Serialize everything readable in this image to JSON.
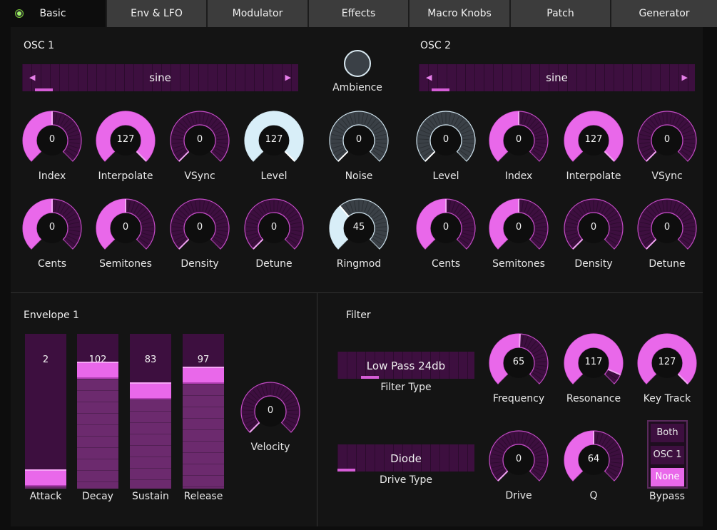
{
  "tabs": {
    "items": [
      {
        "label": "Basic",
        "active": true
      },
      {
        "label": "Env & LFO"
      },
      {
        "label": "Modulator"
      },
      {
        "label": "Effects"
      },
      {
        "label": "Macro Knobs"
      },
      {
        "label": "Patch"
      },
      {
        "label": "Generator"
      }
    ]
  },
  "osc1": {
    "title": "OSC  1",
    "waveform": "sine",
    "waveform_position": 0.05,
    "knobs": [
      {
        "label": "Index",
        "value": "0",
        "fraction": 0.5,
        "style": "pink"
      },
      {
        "label": "Interpolate",
        "value": "127",
        "fraction": 1.0,
        "style": "pink"
      },
      {
        "label": "VSync",
        "value": "0",
        "fraction": 0.0,
        "style": "pink"
      },
      {
        "label": "Level",
        "value": "127",
        "fraction": 1.0,
        "style": "blue"
      },
      {
        "label": "Cents",
        "value": "0",
        "fraction": 0.5,
        "style": "pink"
      },
      {
        "label": "Semitones",
        "value": "0",
        "fraction": 0.5,
        "style": "pink"
      },
      {
        "label": "Density",
        "value": "0",
        "fraction": 0.0,
        "style": "pink"
      },
      {
        "label": "Detune",
        "value": "0",
        "fraction": 0.0,
        "style": "pink"
      }
    ]
  },
  "middle": {
    "ambience_label": "Ambience",
    "knobs": [
      {
        "label": "Noise",
        "value": "0",
        "fraction": 0.0,
        "style": "blue"
      },
      {
        "label": "Ringmod",
        "value": "45",
        "fraction": 0.35,
        "style": "blue"
      }
    ]
  },
  "osc2": {
    "title": "OSC 2",
    "waveform": "sine",
    "waveform_position": 0.05,
    "knobs": [
      {
        "label": "Level",
        "value": "0",
        "fraction": 0.0,
        "style": "blue"
      },
      {
        "label": "Index",
        "value": "0",
        "fraction": 0.5,
        "style": "pink"
      },
      {
        "label": "Interpolate",
        "value": "127",
        "fraction": 1.0,
        "style": "pink"
      },
      {
        "label": "VSync",
        "value": "0",
        "fraction": 0.0,
        "style": "pink"
      },
      {
        "label": "Cents",
        "value": "0",
        "fraction": 0.5,
        "style": "pink"
      },
      {
        "label": "Semitones",
        "value": "0",
        "fraction": 0.5,
        "style": "pink"
      },
      {
        "label": "Density",
        "value": "0",
        "fraction": 0.0,
        "style": "pink"
      },
      {
        "label": "Detune",
        "value": "0",
        "fraction": 0.0,
        "style": "pink"
      }
    ]
  },
  "envelope": {
    "title": "Envelope 1",
    "sliders": [
      {
        "label": "Attack",
        "value": "2",
        "fraction": 0.015
      },
      {
        "label": "Decay",
        "value": "102",
        "fraction": 0.8
      },
      {
        "label": "Sustain",
        "value": "83",
        "fraction": 0.65
      },
      {
        "label": "Release",
        "value": "97",
        "fraction": 0.76
      }
    ],
    "velocity": {
      "label": "Velocity",
      "value": "0",
      "fraction": 0.0,
      "style": "pink"
    }
  },
  "filter": {
    "title": "Filter",
    "filter_type": {
      "label": "Filter Type",
      "value": "Low Pass 24db",
      "position": 0.2
    },
    "drive_type": {
      "label": "Drive Type",
      "value": "Diode",
      "position": 0.0
    },
    "knobs": [
      {
        "label": "Frequency",
        "value": "65",
        "fraction": 0.51,
        "style": "pink"
      },
      {
        "label": "Resonance",
        "value": "117",
        "fraction": 0.92,
        "style": "pink"
      },
      {
        "label": "Key Track",
        "value": "127",
        "fraction": 1.0,
        "style": "pink"
      },
      {
        "label": "Drive",
        "value": "0",
        "fraction": 0.0,
        "style": "pink"
      },
      {
        "label": "Q",
        "value": "64",
        "fraction": 0.5,
        "style": "pink"
      }
    ],
    "bypass": {
      "label": "Bypass",
      "options": [
        "Both",
        "OSC 1",
        "None"
      ],
      "selected": "None"
    }
  },
  "colors": {
    "accent": "#e968ea",
    "dark_track": "#3d0f3f",
    "blue_fill": "#d8eef8",
    "blue_track": "#3a4046",
    "background": "#0d0d0d",
    "tab_bg": "#3c3c3c",
    "led": "#9ef06a"
  }
}
